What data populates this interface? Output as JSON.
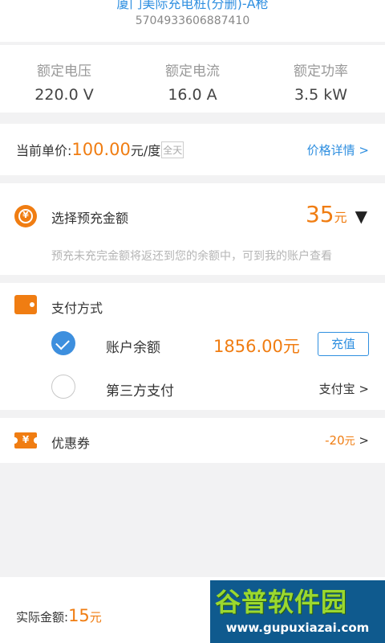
{
  "station": {
    "name": "厦门美际充电桩(分删)-A枪",
    "code": "5704933606887410"
  },
  "ratings": [
    {
      "label": "额定电压",
      "value": "220.0 V"
    },
    {
      "label": "额定电流",
      "value": "16.0 A"
    },
    {
      "label": "额定功率",
      "value": "3.5 kW"
    }
  ],
  "price": {
    "label": "当前单价:",
    "amount": "100.00",
    "unit": "元/度",
    "tag": "全天",
    "details_link": "价格详情 >"
  },
  "prepay": {
    "icon": "yuan-coin-icon",
    "coin_glyph": "¥",
    "title": "选择预充金额",
    "amount": "35",
    "unit": "元",
    "dropdown_glyph": "▼",
    "hint": "预充未充完金额将返还到您的余额中，可到我的账户查看"
  },
  "payment": {
    "icon": "wallet-icon",
    "title": "支付方式",
    "option_balance": {
      "label": "账户余额",
      "amount": "1856.00元",
      "selected": true
    },
    "recharge_label": "充值",
    "option_third_party": {
      "label": "第三方支付",
      "value": "支付宝 >",
      "selected": false
    }
  },
  "coupon": {
    "icon": "coupon-ticket-icon",
    "ticket_glyph": "¥",
    "title": "优惠券",
    "discount": "-20",
    "unit": "元",
    "chevron": ">"
  },
  "bottom": {
    "label": "实际金额:",
    "amount": "15",
    "unit": "元"
  },
  "watermark": {
    "title": "谷普软件园",
    "url": "www.gupuxiazai.com"
  },
  "colors": {
    "accent_orange": "#f07d12",
    "link_blue": "#2f8fe0",
    "background": "#f2f2f3"
  }
}
